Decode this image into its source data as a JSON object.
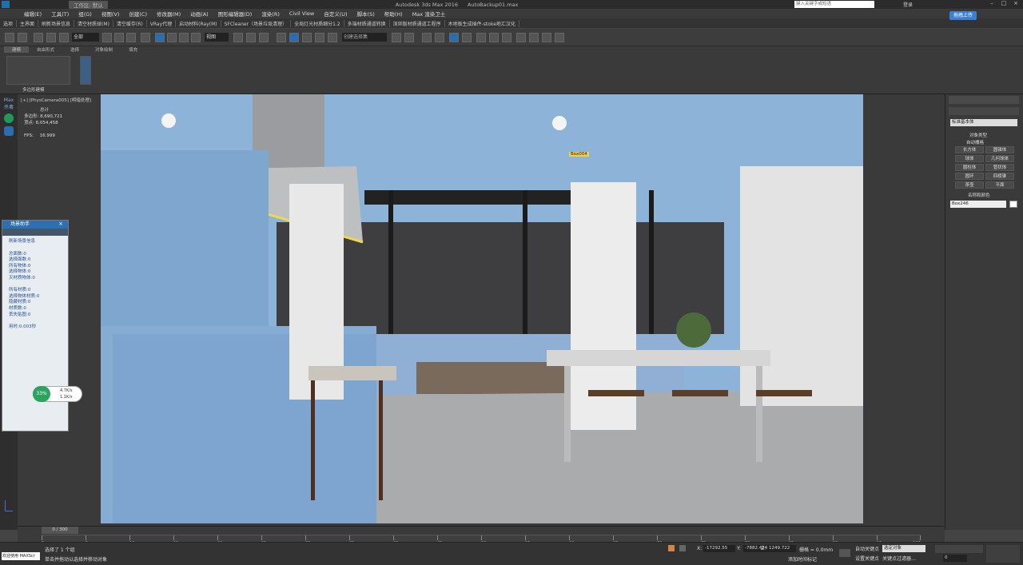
{
  "titlebar": {
    "workspace": "工作区: 默认",
    "app_title": "Autodesk 3ds Max 2016",
    "file_title": "AutoBackup01.max",
    "search_placeholder": "键入关键字或短语",
    "user": "登录"
  },
  "menu": [
    "编辑(E)",
    "工具(T)",
    "组(G)",
    "视图(V)",
    "创建(C)",
    "修改器(M)",
    "动画(A)",
    "图形编辑器(D)",
    "渲染(R)",
    "Civil View",
    "自定义(U)",
    "脚本(S)",
    "帮助(H)",
    "Max 渲染卫士"
  ],
  "ribbon_links": [
    "选项",
    "主界面",
    "刷新场景信息",
    "清空材质球(M)",
    "清空缓存(R)",
    "VRay代理",
    "启动材料(Ray(M)",
    "SFCleaner（场景垃圾清理）",
    "全局灯光材质细分1.2",
    "多端材质通道转换",
    "深圳版材质通道工程序",
    "木地板生成插件-stoke地汇汉化"
  ],
  "upload_label": "拖拽上传",
  "toolbar": {
    "selection_filter": "全部",
    "ref_coord": "视图",
    "named_sel": "创建选择集"
  },
  "ribbon": {
    "tabs": [
      "建模",
      "自由形式",
      "选择",
      "对象绘制",
      "填充"
    ],
    "poly_label": "多边形建模"
  },
  "viewport": {
    "label": "[+] [PhysCamera005] [明暗处理]",
    "stats_total_label": "总计",
    "polys_label": "多边形:",
    "polys": "8,690,721",
    "verts_label": "顶点:",
    "verts": "8,054,458",
    "fps_label": "FPS:",
    "fps": "16.999",
    "box_tag": "Box004"
  },
  "leftrail": {
    "max_label": "Max",
    "sub": "杀毒"
  },
  "float_panel": {
    "title": "场景助手",
    "refresh": "刷新场景信息",
    "lines": [
      "总面数:0",
      "选择面数:0",
      "所有物体:0",
      "选择物体:0",
      "灭材质物体:0",
      "",
      "所有材质:0",
      "选择物体材质:0",
      "隐藏材质:0",
      "材质数:0",
      "丢失贴图:0",
      "",
      "用时:0.003秒"
    ]
  },
  "widget": {
    "percent": "33%",
    "up": "4.7K/s",
    "down": "1.1K/s"
  },
  "right_panel": {
    "dropdown": "标准基本体",
    "object_type": "对象类型",
    "autogrid": "自动栅格",
    "buttons": [
      "长方体",
      "圆锥体",
      "球体",
      "几何球体",
      "圆柱体",
      "管状体",
      "圆环",
      "四棱锥",
      "茶壶",
      "平面"
    ],
    "name_color": "名称和颜色",
    "name_value": "Box246"
  },
  "timeline": {
    "frame": "0 / 300",
    "ticks": [
      "0",
      "5",
      "10",
      "15",
      "20",
      "25",
      "30",
      "35",
      "40",
      "45",
      "50",
      "55",
      "60",
      "65",
      "70",
      "75",
      "80",
      "85",
      "90",
      "95",
      "100"
    ]
  },
  "status": {
    "selected": "选择了 1 个组",
    "hint": "单击并拖动以选择并移动对象",
    "x_label": "X:",
    "x": "-17292.55",
    "y_label": "Y:",
    "y": "-7882.424",
    "z_label": "Z:",
    "z": "1249.722",
    "grid": "栅格 = 0.0mm",
    "autokey": "自动关键点",
    "setkey": "设置关键点",
    "key_filter": "关键点过滤器...",
    "sel_mode": "选定对象",
    "add_tag": "添加时间标记",
    "frame_field": "0",
    "bottom_label": "欢迎使用 MAXScr"
  },
  "colors": {
    "accent": "#2a6db0",
    "scene_sky": "#8db3d9"
  }
}
